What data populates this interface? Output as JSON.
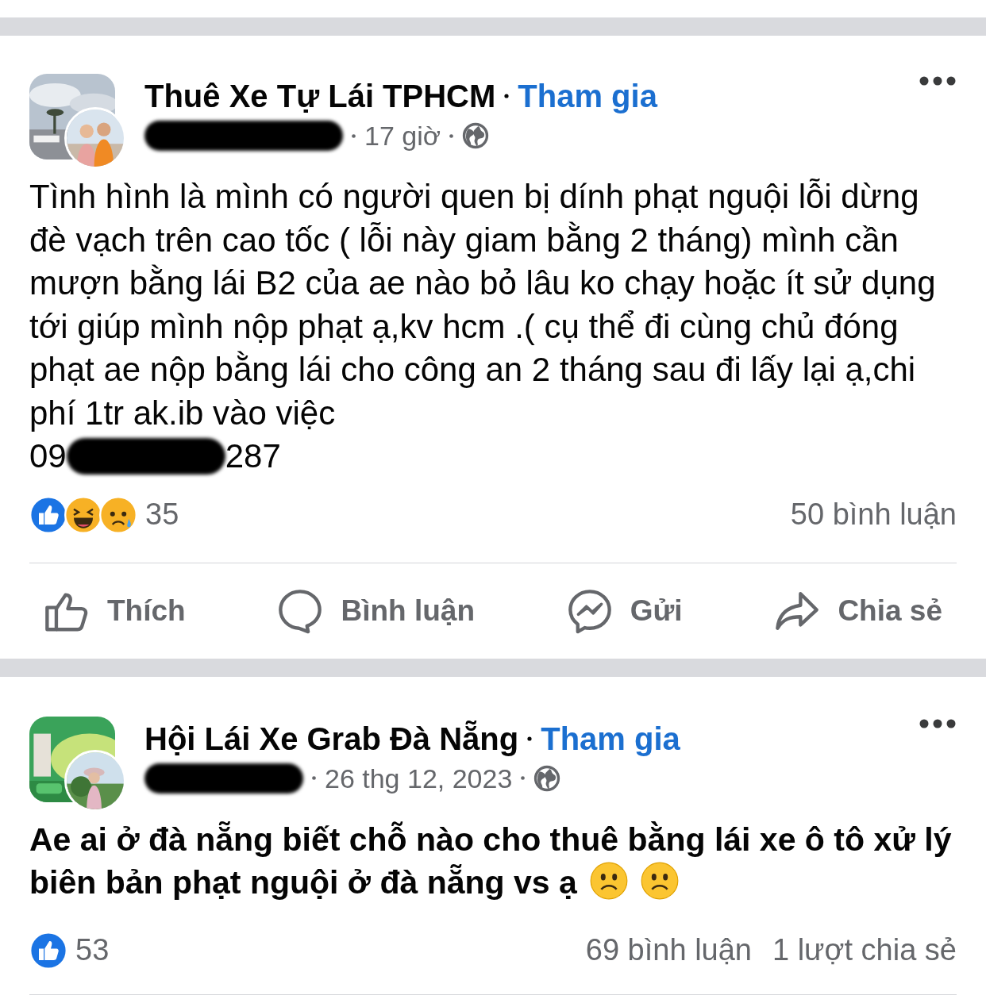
{
  "posts": [
    {
      "group_name": "Thuê Xe Tự Lái TPHCM",
      "join_label": "Tham gia",
      "author_redacted": true,
      "time": "17 giờ",
      "bold": false,
      "body": "Tình hình là mình có người quen bị dính phạt nguội lỗi dừng đè vạch trên cao tốc ( lỗi này giam bằng 2 tháng) mình cần mượn bằng lái B2 của ae nào bỏ lâu ko chạy hoặc ít sử dụng tới giúp mình nộp phạt ạ,kv hcm .( cụ thể đi cùng chủ đóng phạt ae nộp bằng lái cho công an 2 tháng sau đi lấy lại ạ,chi phí 1tr ak.ib vào việc",
      "phone_start": "09",
      "phone_end": "287",
      "reactions": [
        {
          "kind": "like"
        },
        {
          "kind": "haha"
        },
        {
          "kind": "sad"
        }
      ],
      "reaction_count": "35",
      "comment_count": "50 bình luận",
      "actions": [
        {
          "kind": "like",
          "label": "Thích"
        },
        {
          "kind": "comment",
          "label": "Bình luận"
        },
        {
          "kind": "send",
          "label": "Gửi"
        },
        {
          "kind": "share",
          "label": "Chia sẻ"
        }
      ]
    },
    {
      "group_name": "Hội Lái Xe Grab Đà Nẵng",
      "join_label": "Tham gia",
      "author_redacted": true,
      "time": "26 thg 12, 2023",
      "bold": true,
      "body": "Ae ai ở đà nẵng biết chỗ nào cho thuê bằng lái xe ô tô xử lý biên bản phạt nguội ở đà nẵng vs ạ",
      "emojis": [
        {
          "kind": "frown"
        },
        {
          "kind": "frown"
        }
      ],
      "reactions": [
        {
          "kind": "like"
        }
      ],
      "reaction_count": "53",
      "comment_count": "69 bình luận",
      "share_count": "1 lượt chia sẻ"
    }
  ]
}
